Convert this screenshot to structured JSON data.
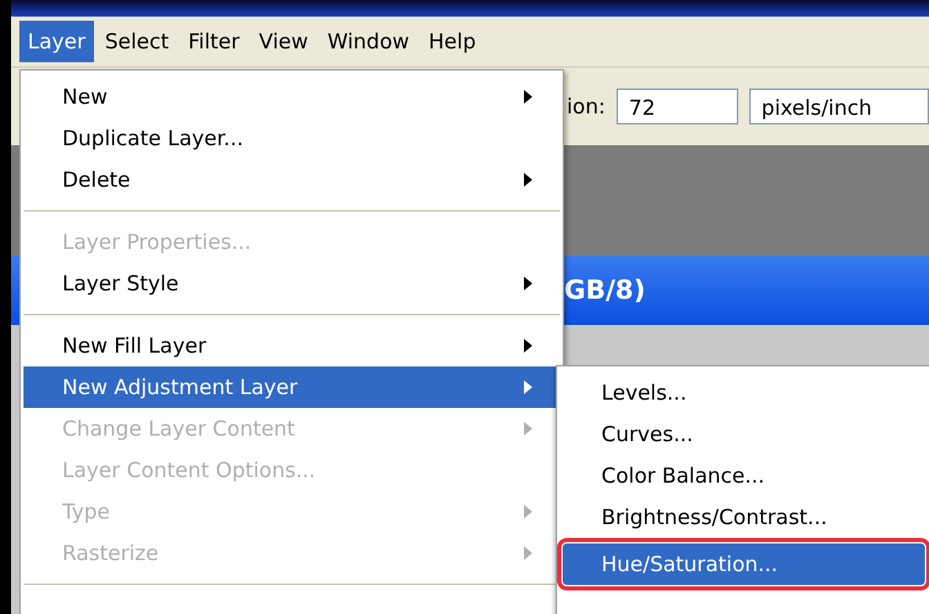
{
  "menubar": [
    {
      "label": "Layer",
      "selected": true
    },
    {
      "label": "Select",
      "selected": false
    },
    {
      "label": "Filter",
      "selected": false
    },
    {
      "label": "View",
      "selected": false
    },
    {
      "label": "Window",
      "selected": false
    },
    {
      "label": "Help",
      "selected": false
    }
  ],
  "options_bar": {
    "label": "ion:",
    "resolution": "72",
    "units": "pixels/inch"
  },
  "document": {
    "title": "GB/8)"
  },
  "menu": [
    {
      "kind": "item",
      "label": "New",
      "submenu": true,
      "disabled": false,
      "selected": false
    },
    {
      "kind": "item",
      "label": "Duplicate Layer...",
      "submenu": false,
      "disabled": false,
      "selected": false
    },
    {
      "kind": "item",
      "label": "Delete",
      "submenu": true,
      "disabled": false,
      "selected": false
    },
    {
      "kind": "separator"
    },
    {
      "kind": "item",
      "label": "Layer Properties...",
      "submenu": false,
      "disabled": true,
      "selected": false
    },
    {
      "kind": "item",
      "label": "Layer Style",
      "submenu": true,
      "disabled": false,
      "selected": false
    },
    {
      "kind": "separator"
    },
    {
      "kind": "item",
      "label": "New Fill Layer",
      "submenu": true,
      "disabled": false,
      "selected": false
    },
    {
      "kind": "item",
      "label": "New Adjustment Layer",
      "submenu": true,
      "disabled": false,
      "selected": true
    },
    {
      "kind": "item",
      "label": "Change Layer Content",
      "submenu": true,
      "disabled": true,
      "selected": false
    },
    {
      "kind": "item",
      "label": "Layer Content Options...",
      "submenu": false,
      "disabled": true,
      "selected": false
    },
    {
      "kind": "item",
      "label": "Type",
      "submenu": true,
      "disabled": true,
      "selected": false
    },
    {
      "kind": "item",
      "label": "Rasterize",
      "submenu": true,
      "disabled": true,
      "selected": false
    },
    {
      "kind": "separator"
    }
  ],
  "submenu": [
    {
      "label": "Levels...",
      "selected": false,
      "outlined": false
    },
    {
      "label": "Curves...",
      "selected": false,
      "outlined": false
    },
    {
      "label": "Color Balance...",
      "selected": false,
      "outlined": false
    },
    {
      "label": "Brightness/Contrast...",
      "selected": false,
      "outlined": false
    },
    {
      "label": "Hue/Saturation...",
      "selected": true,
      "outlined": true
    }
  ]
}
